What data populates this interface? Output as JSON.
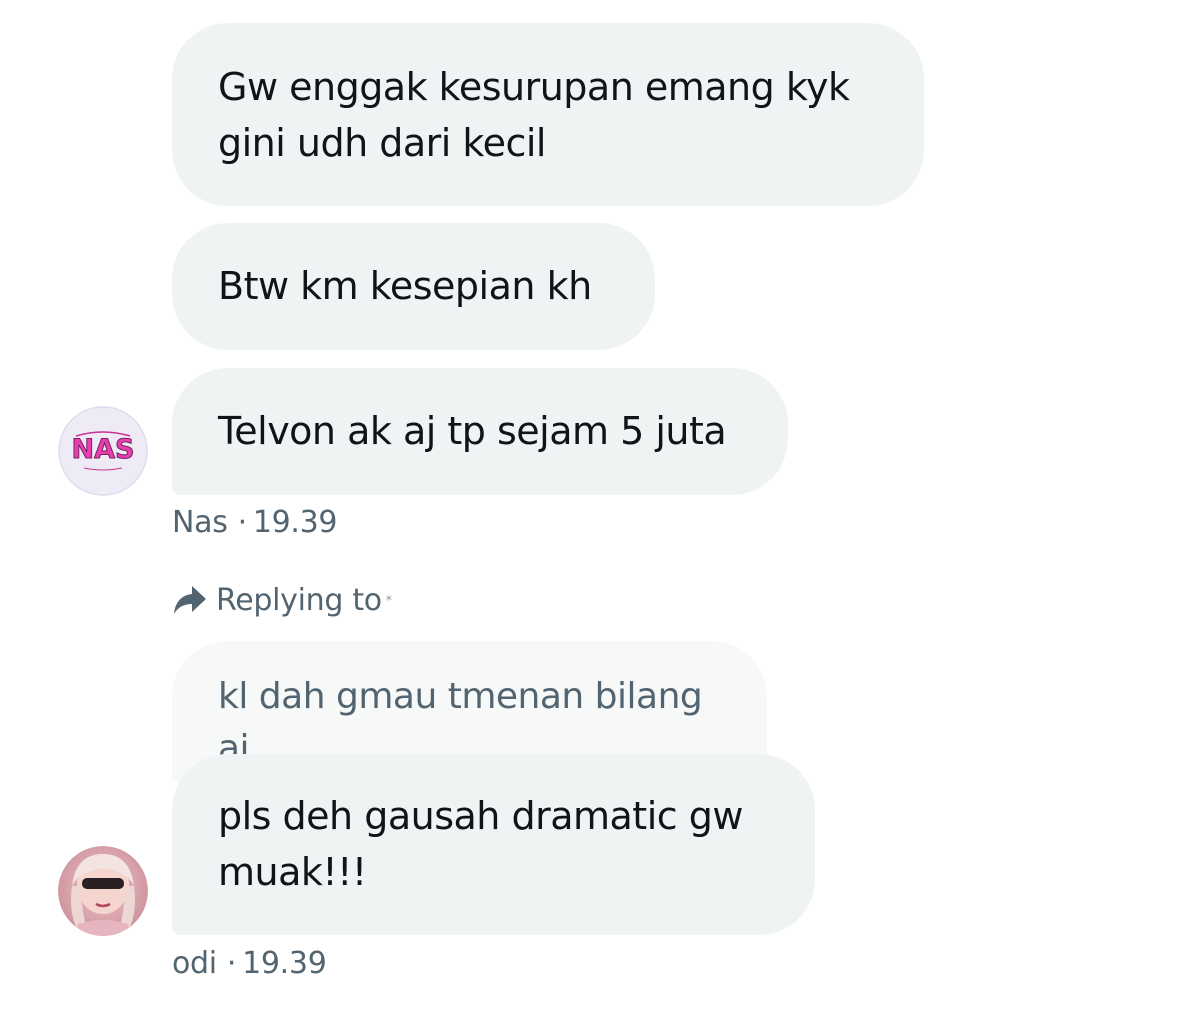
{
  "messages": [
    {
      "text": "Gw enggak kesurupan emang kyk gini udh dari kecil"
    },
    {
      "text": "Btw km kesepian kh"
    },
    {
      "text": "Telvon ak aj tp sejam 5 juta"
    }
  ],
  "first_group_meta": {
    "sender": "Nas",
    "time": "19.39"
  },
  "first_avatar": {
    "text": "NAS",
    "colors": {
      "bg": "#eeeaf6",
      "accent": "#e83fb0"
    }
  },
  "reply": {
    "label": "Replying to",
    "quoted_text": "kl dah gmau tmenan bilang aj"
  },
  "second_message": {
    "text": "pls deh gausah dramatic gw muak!!!"
  },
  "second_group_meta": {
    "sender": "odi",
    "time": "19.39"
  },
  "colors": {
    "bubble": "#eff3f4",
    "quoted_bubble": "#f7f9f9",
    "secondary_text": "#536471"
  }
}
